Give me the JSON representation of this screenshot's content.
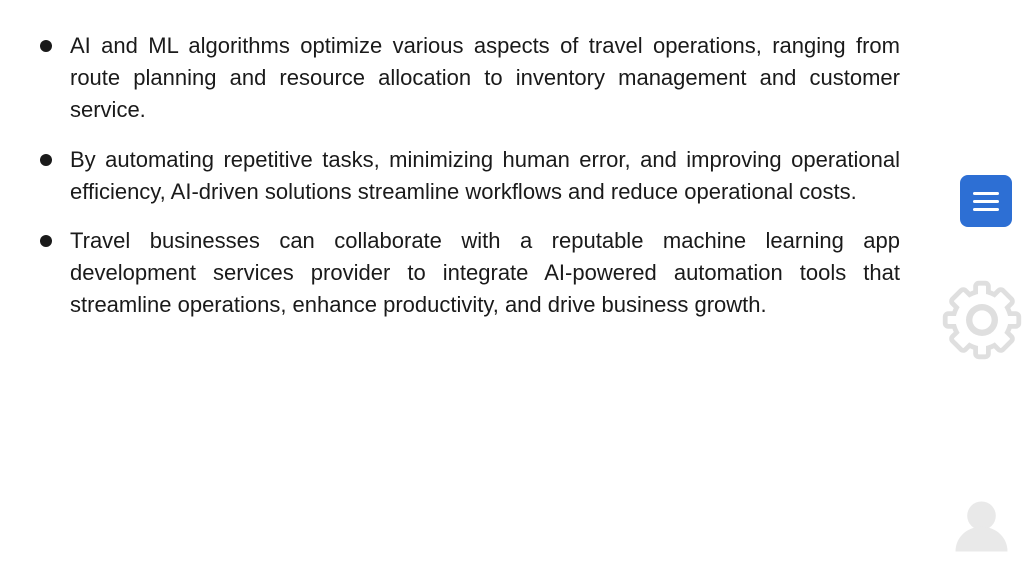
{
  "bullets": [
    {
      "id": "bullet-1",
      "text": "AI and ML algorithms optimize various aspects of travel operations, ranging from route planning and resource allocation to inventory management and customer service."
    },
    {
      "id": "bullet-2",
      "text": "By automating repetitive tasks, minimizing human error, and improving operational efficiency, AI-driven solutions streamline workflows and reduce operational costs."
    },
    {
      "id": "bullet-3",
      "text": "Travel businesses can collaborate with a reputable machine learning app development services provider to integrate AI-powered automation tools that streamline operations, enhance productivity, and drive business growth."
    }
  ],
  "menu_button": {
    "aria_label": "Menu"
  },
  "icons": {
    "gear": "gear-icon",
    "avatar": "avatar-icon",
    "menu": "menu-icon"
  }
}
